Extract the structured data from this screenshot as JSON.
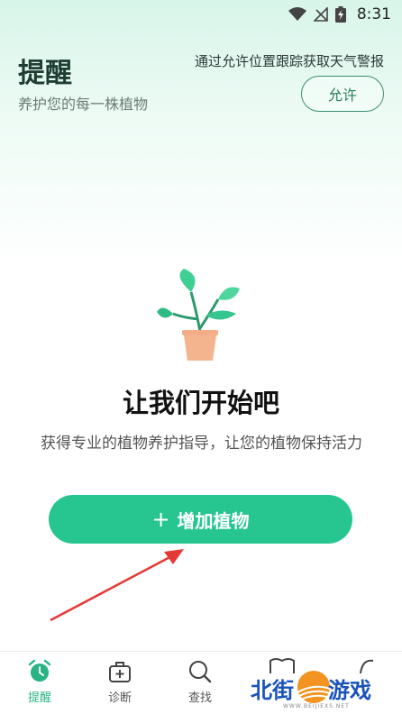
{
  "status_bar": {
    "time": "8:31"
  },
  "header": {
    "title": "提醒",
    "subtitle": "养护您的每一株植物",
    "weather_prompt": "通过允许位置跟踪获取天气警报",
    "allow_label": "允许"
  },
  "empty_state": {
    "title": "让我们开始吧",
    "description": "获得专业的植物养护指导，让您的植物保持活力",
    "add_button_label": "增加植物"
  },
  "bottom_nav": {
    "items": [
      {
        "label": "提醒",
        "icon": "alarm-clock-icon",
        "active": true
      },
      {
        "label": "诊断",
        "icon": "medical-kit-icon",
        "active": false
      },
      {
        "label": "查找",
        "icon": "search-icon",
        "active": false
      }
    ]
  },
  "watermark": {
    "left": "北街",
    "right": "游戏",
    "url": "WWW.BEIJIEXS.NET"
  },
  "colors": {
    "accent": "#27c691",
    "title": "#1e3d33",
    "annotation": "#e53935"
  }
}
